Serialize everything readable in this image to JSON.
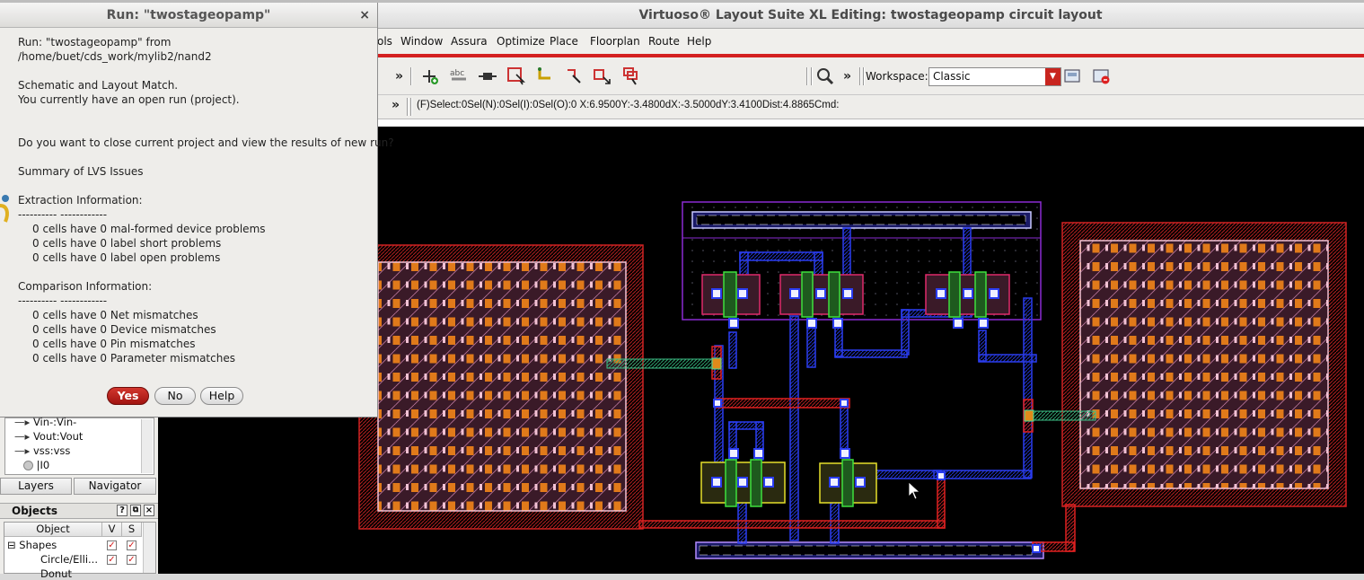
{
  "window": {
    "title": "Virtuoso® Layout Suite XL Editing: twostageopamp circuit layout"
  },
  "menu": {
    "items": [
      "ols",
      "Window",
      "Assura",
      "Optimize",
      "Place",
      "Floorplan",
      "Route",
      "Help"
    ]
  },
  "toolbar": {
    "workspace_label": "Workspace:",
    "workspace_value": "Classic"
  },
  "status": {
    "text": "(F)Select:0Sel(N):0Sel(I):0Sel(O):0 X:6.9500Y:-3.4800dX:-3.5000dY:3.4100Dist:4.8865Cmd:"
  },
  "dialog": {
    "title": "Run: \"twostageopamp\"",
    "close": "×",
    "line1": "Run: \"twostageopamp\"  from",
    "line2": "/home/buet/cds_work/mylib2/nand2",
    "line3": "Schematic and Layout Match.",
    "line4": "You currently have an open run (project).",
    "line5": "Do you want to close current project and view the results of new run?",
    "line6": "Summary of LVS Issues",
    "extraction": {
      "heading": "Extraction Information:",
      "rule": "---------- ------------",
      "items": [
        "0 cells have 0 mal-formed device problems",
        "0 cells have 0 label short problems",
        "0 cells have 0 label open problems"
      ]
    },
    "comparison": {
      "heading": "Comparison Information:",
      "rule": "---------- ------------",
      "items": [
        "0 cells have 0 Net mismatches",
        "0 cells have 0 Device mismatches",
        "0 cells have 0 Pin mismatches",
        "0 cells have 0 Parameter mismatches"
      ]
    },
    "buttons": {
      "yes": "Yes",
      "no": "No",
      "help": "Help"
    }
  },
  "navigator": {
    "tree_rows": [
      "Vin-:Vin-",
      "Vout:Vout",
      "vss:vss",
      "|I0"
    ],
    "tabs": {
      "layers": "Layers",
      "navigator": "Navigator"
    }
  },
  "objects_panel": {
    "title": "Objects",
    "header_buttons": [
      "?",
      "⧉",
      "×"
    ],
    "columns": [
      "Object",
      "V",
      "S"
    ],
    "rows": [
      {
        "label": "Shapes",
        "expander": "⊟"
      },
      {
        "label": "Circle/Elli..."
      },
      {
        "label": "Donut"
      }
    ]
  }
}
